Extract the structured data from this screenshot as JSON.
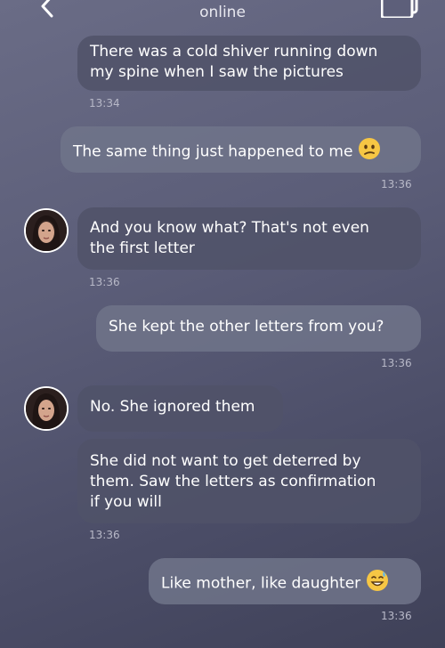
{
  "header": {
    "status": "online",
    "back_icon": "chevron-left-icon",
    "gallery_icon": "gallery-icon"
  },
  "messages": [
    {
      "text_lines": [
        "There was a cold shiver running down",
        "my spine when I saw the pictures"
      ],
      "time": "13:34",
      "direction": "incoming"
    },
    {
      "text": "The same thing just happened to me",
      "emoji": "confused-face",
      "time": "13:36",
      "direction": "outgoing"
    },
    {
      "text_lines": [
        "And you know what? That's not even",
        "the first letter"
      ],
      "time": "13:36",
      "direction": "incoming"
    },
    {
      "text": "She kept the other letters from you?",
      "time": "13:36",
      "direction": "outgoing"
    },
    {
      "text": "No. She ignored them",
      "direction": "incoming"
    },
    {
      "text_lines": [
        "She did not want to get deterred by",
        "them. Saw the letters as confirmation",
        "if you will"
      ],
      "time": "13:36",
      "direction": "incoming"
    },
    {
      "text": "Like mother, like daughter",
      "emoji": "grinning-sweat-face",
      "time": "13:36",
      "direction": "outgoing"
    }
  ]
}
